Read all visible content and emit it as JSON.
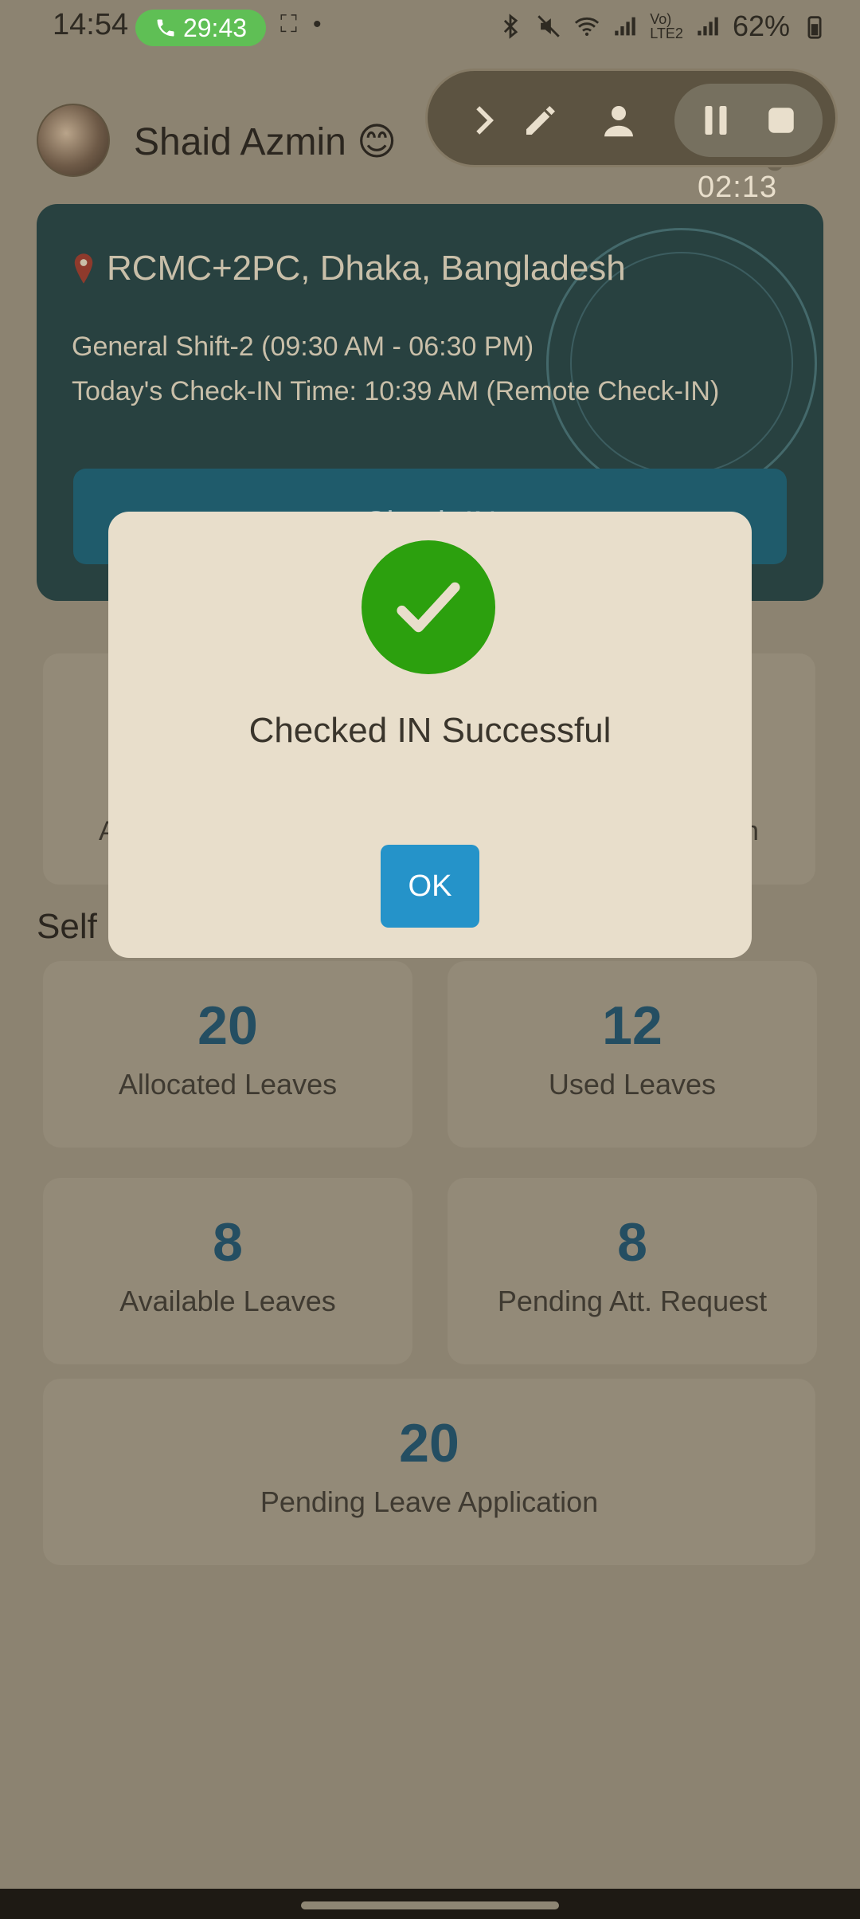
{
  "status_bar": {
    "time": "14:54",
    "call_timer": "29:43",
    "battery": "62%"
  },
  "header": {
    "user_name": "Shaid Azmin 😊"
  },
  "recorder": {
    "elapsed": "02:13"
  },
  "location_card": {
    "location": "RCMC+2PC, Dhaka, Bangladesh",
    "shift": "General Shift-2 (09:30 AM - 06:30 PM)",
    "checkin_time": "Today's Check-IN Time: 10:39 AM (Remote Check-IN)",
    "checkin_button": "Check-IN"
  },
  "summary_card": {
    "left_fragment": "A",
    "right_fragment": "n"
  },
  "section": {
    "title_fragment": "Self C"
  },
  "stats": [
    {
      "value": "20",
      "label": "Allocated Leaves"
    },
    {
      "value": "12",
      "label": "Used Leaves"
    },
    {
      "value": "8",
      "label": "Available Leaves"
    },
    {
      "value": "8",
      "label": "Pending Att. Request"
    },
    {
      "value": "20",
      "label": "Pending Leave Application"
    }
  ],
  "dialog": {
    "message": "Checked IN Successful",
    "ok_label": "OK"
  },
  "colors": {
    "success_green": "#2ca00e",
    "ok_blue": "#2593c9",
    "stat_number": "#244e62"
  }
}
